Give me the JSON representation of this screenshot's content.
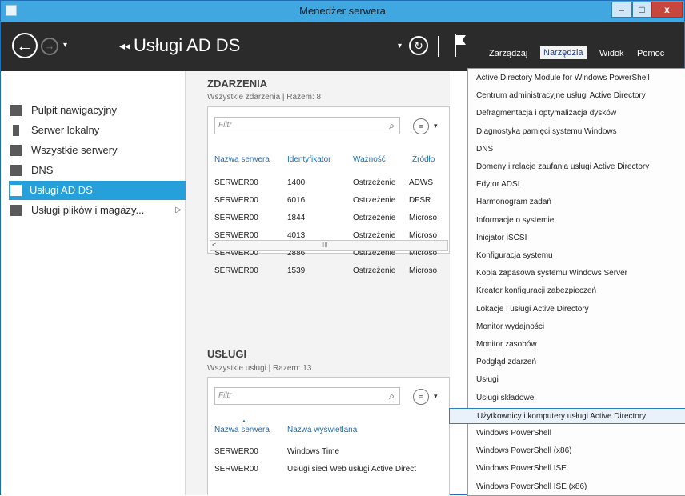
{
  "window": {
    "title": "Menedżer serwera",
    "min": "–",
    "max": "□",
    "close": "x"
  },
  "navbar": {
    "back": "←",
    "forward": "→",
    "history": "▾",
    "breadcrumb_arrows": "◂◂",
    "breadcrumb": "Usługi AD DS",
    "bc_dropdown": "▾",
    "refresh": "↻",
    "menus": [
      "Zarządzaj",
      "Narzędzia",
      "Widok",
      "Pomoc"
    ],
    "active_menu": "Narzędzia"
  },
  "sidebar": {
    "items": [
      {
        "label": "Pulpit nawigacyjny",
        "icon": "dashboard-icon"
      },
      {
        "label": "Serwer lokalny",
        "icon": "server-icon"
      },
      {
        "label": "Wszystkie serwery",
        "icon": "servers-icon"
      },
      {
        "label": "DNS",
        "icon": "dns-icon"
      },
      {
        "label": "Usługi AD DS",
        "icon": "ad-ds-icon",
        "active": true
      },
      {
        "label": "Usługi plików i magazy...",
        "icon": "file-services-icon",
        "chevron": "▷"
      }
    ]
  },
  "events": {
    "title": "ZDARZENIA",
    "subtitle": "Wszystkie zdarzenia | Razem: 8",
    "filter_placeholder": "Filtr",
    "columns": [
      "Nazwa serwera",
      "Identyfikator",
      "Ważność",
      "Źródło"
    ],
    "rows": [
      [
        "SERWER00",
        "1400",
        "Ostrzeżenie",
        "ADWS"
      ],
      [
        "SERWER00",
        "6016",
        "Ostrzeżenie",
        "DFSR"
      ],
      [
        "SERWER00",
        "1844",
        "Ostrzeżenie",
        "Microso"
      ],
      [
        "SERWER00",
        "4013",
        "Ostrzeżenie",
        "Microso"
      ],
      [
        "SERWER00",
        "2886",
        "Ostrzeżenie",
        "Microso"
      ],
      [
        "SERWER00",
        "1539",
        "Ostrzeżenie",
        "Microso"
      ]
    ],
    "scroll_left": "<",
    "scroll_grip": "III"
  },
  "services": {
    "title": "USŁUGI",
    "subtitle": "Wszystkie usługi | Razem: 13",
    "filter_placeholder": "Filtr",
    "columns": [
      "Nazwa serwera",
      "Nazwa wyświetlana"
    ],
    "rows": [
      [
        "SERWER00",
        "Windows Time"
      ],
      [
        "SERWER00",
        "Usługi sieci Web usługi Active Direct"
      ]
    ]
  },
  "tools_menu": {
    "items": [
      "Active Directory Module for Windows PowerShell",
      "Centrum administracyjne usługi Active Directory",
      "Defragmentacja i optymalizacja dysków",
      "Diagnostyka pamięci systemu Windows",
      "DNS",
      "Domeny i relacje zaufania usługi Active Directory",
      "Edytor ADSI",
      "Harmonogram zadań",
      "Informacje o systemie",
      "Inicjator iSCSI",
      "Konfiguracja systemu",
      "Kopia zapasowa systemu Windows Server",
      "Kreator konfiguracji zabezpieczeń",
      "Lokacje i usługi Active Directory",
      "Monitor wydajności",
      "Monitor zasobów",
      "Podgląd zdarzeń",
      "Usługi",
      "Usługi składowe",
      "Użytkownicy i komputery usługi Active Directory",
      "Windows PowerShell",
      "Windows PowerShell (x86)",
      "Windows PowerShell ISE",
      "Windows PowerShell ISE (x86)"
    ],
    "highlighted": "Użytkownicy i komputery usługi Active Directory"
  }
}
